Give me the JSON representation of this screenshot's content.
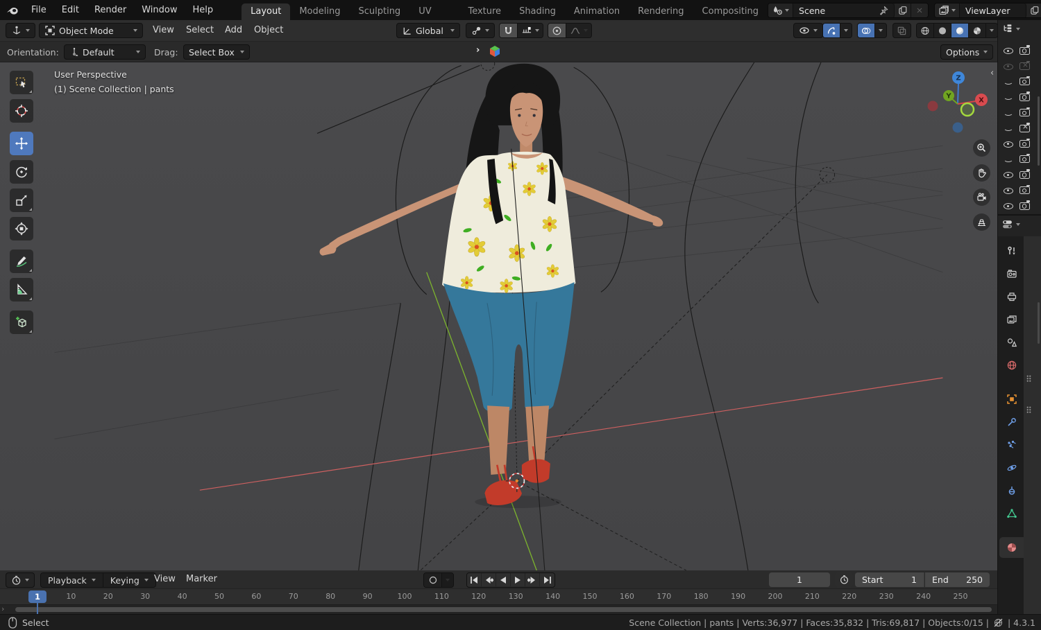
{
  "topbar": {
    "menus": [
      "File",
      "Edit",
      "Render",
      "Window",
      "Help"
    ],
    "tabs": [
      {
        "label": "Layout",
        "active": true
      },
      {
        "label": "Modeling",
        "active": false
      },
      {
        "label": "Sculpting",
        "active": false
      },
      {
        "label": "UV Editing",
        "active": false
      },
      {
        "label": "Texture Paint",
        "active": false
      },
      {
        "label": "Shading",
        "active": false
      },
      {
        "label": "Animation",
        "active": false
      },
      {
        "label": "Rendering",
        "active": false
      },
      {
        "label": "Compositing",
        "active": false
      }
    ],
    "scene_selector": {
      "value": "Scene"
    },
    "view_layer_selector": {
      "value": "ViewLayer"
    }
  },
  "viewport_header": {
    "mode": "Object Mode",
    "menus": [
      "View",
      "Select",
      "Add",
      "Object"
    ],
    "transform_orientation": "Global"
  },
  "tool_settings": {
    "orientation_label": "Orientation:",
    "orientation_value": "Default",
    "drag_label": "Drag:",
    "drag_value": "Select Box",
    "options_label": "Options"
  },
  "left_toolbar": {
    "tools": [
      "tweak-select",
      "cursor",
      "move",
      "rotate",
      "scale",
      "transform",
      "annotate",
      "measure",
      "add-cube"
    ],
    "active_tool": "move"
  },
  "viewport": {
    "overlay_line1": "User Perspective",
    "overlay_line2": "(1) Scene Collection | pants",
    "gizmo_axes": {
      "x": "X",
      "y": "Y",
      "z": "Z"
    }
  },
  "outliner": {
    "rows": [
      {
        "eye": "open",
        "camera": "on"
      },
      {
        "eye": "open dim",
        "camera": "x dim"
      },
      {
        "eye": "closed",
        "camera": "on"
      },
      {
        "eye": "closed",
        "camera": "on"
      },
      {
        "eye": "closed",
        "camera": "on"
      },
      {
        "eye": "closed",
        "camera": "x"
      },
      {
        "eye": "open",
        "camera": "on"
      },
      {
        "eye": "closed",
        "camera": "on"
      },
      {
        "eye": "open",
        "camera": "on"
      },
      {
        "eye": "open",
        "camera": "on"
      },
      {
        "eye": "open",
        "camera": "on"
      }
    ]
  },
  "properties": {
    "tabs": [
      "tool",
      "render",
      "output",
      "view-layer",
      "scene",
      "world",
      "object",
      "modifiers",
      "particles",
      "physics",
      "constraints",
      "object-data",
      "material"
    ],
    "active_tab": "material"
  },
  "timeline": {
    "menus": [
      "Playback",
      "Keying",
      "View",
      "Marker"
    ],
    "current_frame": "1",
    "playhead_frame": "1",
    "start_label": "Start",
    "start_value": "1",
    "end_label": "End",
    "end_value": "250",
    "ruler_ticks": [
      10,
      20,
      30,
      40,
      50,
      60,
      70,
      80,
      90,
      100,
      110,
      120,
      130,
      140,
      150,
      160,
      170,
      180,
      190,
      200,
      210,
      220,
      230,
      240,
      250
    ]
  },
  "status_bar": {
    "mode_hint": "Select",
    "stats": "Scene Collection | pants | Verts:36,977 | Faces:35,832 | Tris:69,817 | Objects:0/15 |",
    "version": "| 4.3.1"
  },
  "colors": {
    "accent_blue": "#4772b3",
    "axis_x": "#d94b4f",
    "axis_y": "#77b62d",
    "axis_z": "#3f7ad0",
    "object_orange": "#e79132",
    "material_pink": "#e48a8a",
    "viewport_bg": "#48484a"
  }
}
